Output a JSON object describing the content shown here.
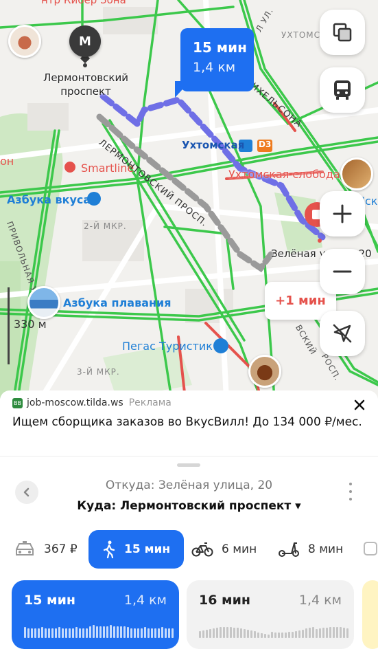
{
  "map": {
    "metro_letter": "М",
    "metro_station_name": "Лермонтовский проспект",
    "top_cut_label": "нтр Кибер Зона",
    "route_bubble": {
      "time": "15 мин",
      "distance": "1,4 км"
    },
    "alt_route_delta": "+1 мин",
    "destination_label": "Зелёная улица, 20",
    "scale": "330 м",
    "pois": {
      "smartline": "Smartline",
      "azbuka_vkusa": "Азбука вкуса",
      "azbuka_plavaniya": "Азбука плавания",
      "pegas": "Пегас Туристик",
      "ukhtomskaya": "Ухтомская",
      "d3": "D3",
      "ukhtomskaya_sloboda": "Ухтомская слобода"
    },
    "streets": {
      "lermontovsky": "ЛЕРМОНТОВСКИЙ ПРОСП.",
      "privolnaya": "ПРИВОЛЬНАЯ УЛ.",
      "mkr2": "2-Й МКР.",
      "mkr3": "3-Й МКР.",
      "mikhelsona": "ИХЕЛЬСОНА",
      "ukhtomsk_short": "УХТОМСК",
      "ul": "Л УЛ.",
      "isk": "Иск",
      "on": "он",
      "vskiy": "ВСКИЙ",
      "posp": "РОСП."
    },
    "controls": [
      "layers-button",
      "transit-button",
      "zoom-in-button",
      "zoom-out-button",
      "location-button"
    ]
  },
  "ad": {
    "domain": "job-moscow.tilda.ws",
    "tag": "Реклама",
    "icon_text": "BB",
    "text": "Ищем сборщика заказов во ВкусВилл! До 134 000 ₽/мес."
  },
  "panel": {
    "from": "Откуда: Зелёная улица, 20",
    "to": "Куда: Лермонтовский проспект ▾",
    "modes": [
      {
        "name": "taxi",
        "label": "367 ₽"
      },
      {
        "name": "walk",
        "label": "15 мин",
        "active": true
      },
      {
        "name": "bike",
        "label": "6 мин"
      },
      {
        "name": "scooter",
        "label": "8 мин"
      }
    ],
    "cards": [
      {
        "duration": "15 мин",
        "distance": "1,4 км",
        "selected": true
      },
      {
        "duration": "16 мин",
        "distance": "1,4 км",
        "selected": false
      }
    ]
  },
  "colors": {
    "accent": "#1e6ff1",
    "traffic_green": "#3cc84b",
    "traffic_red": "#e5524c",
    "route_walk": "#6f6fe6",
    "route_alt": "#9a9a9a"
  }
}
